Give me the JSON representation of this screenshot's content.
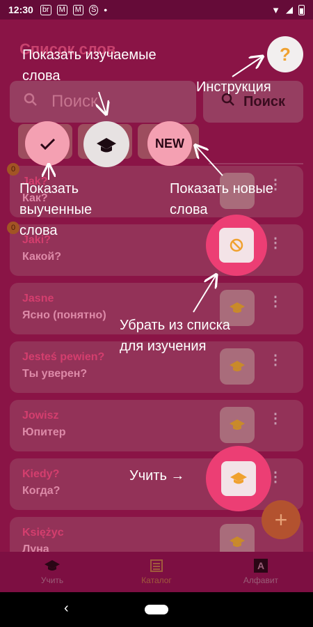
{
  "status": {
    "time": "12:30",
    "icons": [
      "br",
      "M",
      "M",
      "S"
    ]
  },
  "header": {
    "title": "Список слов",
    "search_placeholder": "Поиск",
    "search_button": "Поиск"
  },
  "filters": {
    "learned_icon": "check-icon",
    "learning_icon": "graduation-cap-icon",
    "new_label": "NEW"
  },
  "words": [
    {
      "word": "Jak?",
      "translation": "Как?",
      "badge": "0"
    },
    {
      "word": "Jaki?",
      "translation": "Какой?",
      "badge": "0"
    },
    {
      "word": "Jasne",
      "translation": "Ясно (понятно)"
    },
    {
      "word": "Jesteś pewien?",
      "translation": "Ты уверен?"
    },
    {
      "word": "Jowisz",
      "translation": "Юпитер"
    },
    {
      "word": "Kiedy?",
      "translation": "Когда?"
    },
    {
      "word": "Księżyc",
      "translation": "Луна"
    }
  ],
  "fab_add": "+",
  "nav": [
    {
      "label": "Учить",
      "icon": "graduation-cap-icon"
    },
    {
      "label": "Каталог",
      "icon": "catalog-icon"
    },
    {
      "label": "Алфавит",
      "icon": "alphabet-icon",
      "icon_char": "A"
    }
  ],
  "tutorial": {
    "help_mark": "?",
    "show_learning": "Показать изучаемые слова",
    "show_learning_l1": "Показать изучаемые",
    "show_learning_l2": "слова",
    "instruction": "Инструкция",
    "show_learned_l1": "Показать",
    "show_learned_l2": "выученные",
    "show_learned_l3": "слова",
    "show_new_l1": "Показать новые",
    "show_new_l2": "слова",
    "remove_l1": "Убрать из списка",
    "remove_l2": "для изучения",
    "learn": "Учить →"
  },
  "colors": {
    "background": "#8a1446",
    "spotlight": "#ec3e74",
    "accent": "#f0a12f"
  }
}
